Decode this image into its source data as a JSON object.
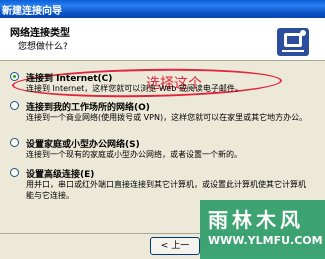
{
  "window": {
    "title": "新建连接向导"
  },
  "header": {
    "title": "网络连接类型",
    "subtitle": "您想做什么?"
  },
  "options": [
    {
      "label": "连接到 Internet(C)",
      "desc": "连接到 Internet，这样您就可以浏览 Web 或阅读电子邮件。",
      "checked": true
    },
    {
      "label": "连接到我的工作场所的网络(O)",
      "desc": "连接到一个商业网络(使用拨号或 VPN)，这样您就可以在家里或其它地方办公。",
      "checked": false
    },
    {
      "label": "设置家庭或小型办公网络(S)",
      "desc": "连接到一个现有的家庭或小型办公网络，或者设置一个新的。",
      "checked": false
    },
    {
      "label": "设置高级连接(E)",
      "desc": "用并口，串口或红外端口直接连接到其它计算机，或设置此计算机使其它计算机能与它连接。",
      "checked": false
    }
  ],
  "annotation": {
    "text": "选择这个",
    "color": "#e2243d"
  },
  "footer": {
    "back_label": "< 上一"
  },
  "watermark": {
    "text": "雨林木风",
    "url": "WWW.YLMFU.COM"
  },
  "colors": {
    "titlebar": "#0a5fd8",
    "dialog_bg": "#ece9d8",
    "accent_red": "#e2243d",
    "watermark_green": "#2f9e6b"
  }
}
